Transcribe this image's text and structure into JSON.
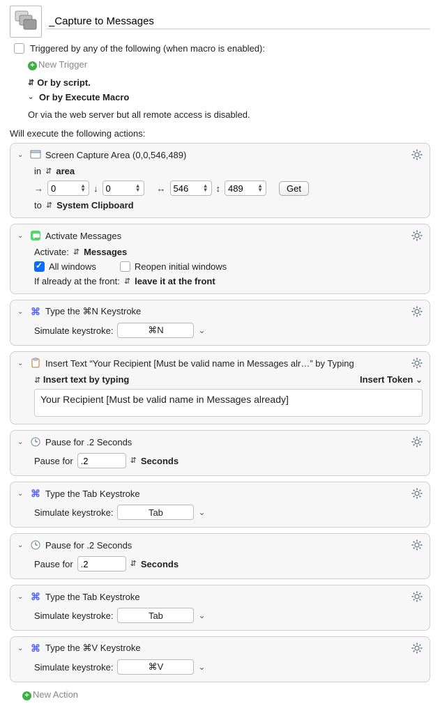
{
  "title": "_Capture to Messages",
  "triggered_by": "Triggered by any of the following (when macro is enabled):",
  "new_trigger": "New Trigger",
  "or_by_script": "Or by script.",
  "or_by_execute": "Or by Execute Macro",
  "or_via": "Or via the web server but all remote access is disabled.",
  "will_execute": "Will execute the following actions:",
  "new_action": "New Action",
  "get_btn": "Get",
  "insert_token": "Insert Token",
  "actions": {
    "a0": {
      "title": "Screen Capture Area (0,0,546,489)",
      "in_label": "in",
      "area_label": "area",
      "x": "0",
      "y": "0",
      "w": "546",
      "h": "489",
      "to_label": "to",
      "to_target": "System Clipboard"
    },
    "a1": {
      "title": "Activate Messages",
      "act_label": "Activate:",
      "act_target": "Messages",
      "all_windows": "All windows",
      "reopen": "Reopen initial windows",
      "front_label": "If already at the front:",
      "front_val": "leave it at the front"
    },
    "a2": {
      "title": "Type the ⌘N Keystroke",
      "sim_label": "Simulate keystroke:",
      "key": "⌘N"
    },
    "a3": {
      "title": "Insert Text “Your Recipient [Must be valid name in Messages alr…” by Typing",
      "method": "Insert text by typing",
      "body": "Your Recipient [Must be valid name in Messages already]"
    },
    "a4": {
      "title": "Pause for .2 Seconds",
      "pause_label": "Pause for",
      "val": ".2",
      "unit": "Seconds"
    },
    "a5": {
      "title": "Type the Tab Keystroke",
      "sim_label": "Simulate keystroke:",
      "key": "Tab"
    },
    "a6": {
      "title": "Pause for .2 Seconds",
      "pause_label": "Pause for",
      "val": ".2",
      "unit": "Seconds"
    },
    "a7": {
      "title": "Type the Tab Keystroke",
      "sim_label": "Simulate keystroke:",
      "key": "Tab"
    },
    "a8": {
      "title": "Type the ⌘V Keystroke",
      "sim_label": "Simulate keystroke:",
      "key": "⌘V"
    }
  }
}
